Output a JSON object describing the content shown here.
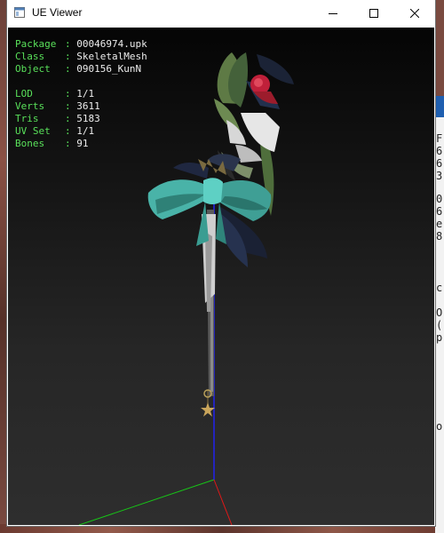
{
  "window": {
    "title": "UE Viewer",
    "controls": [
      "minimize",
      "maximize",
      "close"
    ]
  },
  "info_panel": {
    "package": {
      "label": "Package",
      "value": "00046974.upk"
    },
    "class": {
      "label": "Class",
      "value": "SkeletalMesh"
    },
    "object": {
      "label": "Object",
      "value": "090156_KunN"
    },
    "lod": {
      "label": "LOD",
      "value": "1/1"
    },
    "verts": {
      "label": "Verts",
      "value": "3611"
    },
    "tris": {
      "label": "Tris",
      "value": "5183"
    },
    "uv_set": {
      "label": "UV Set",
      "value": "1/1"
    },
    "bones": {
      "label": "Bones",
      "value": "91"
    }
  },
  "background_window_fragments": [
    "F",
    "6",
    "6",
    "3",
    "0",
    "6",
    "e",
    "8",
    "c",
    "O",
    "(",
    "p",
    "o"
  ],
  "colors": {
    "overlay_label": "#59e05a",
    "overlay_value": "#ececec",
    "axis_x": "#e01818",
    "axis_y": "#17c417",
    "axis_z": "#2222ee",
    "bow": "#49b3a8",
    "rose": "#c0203a"
  }
}
